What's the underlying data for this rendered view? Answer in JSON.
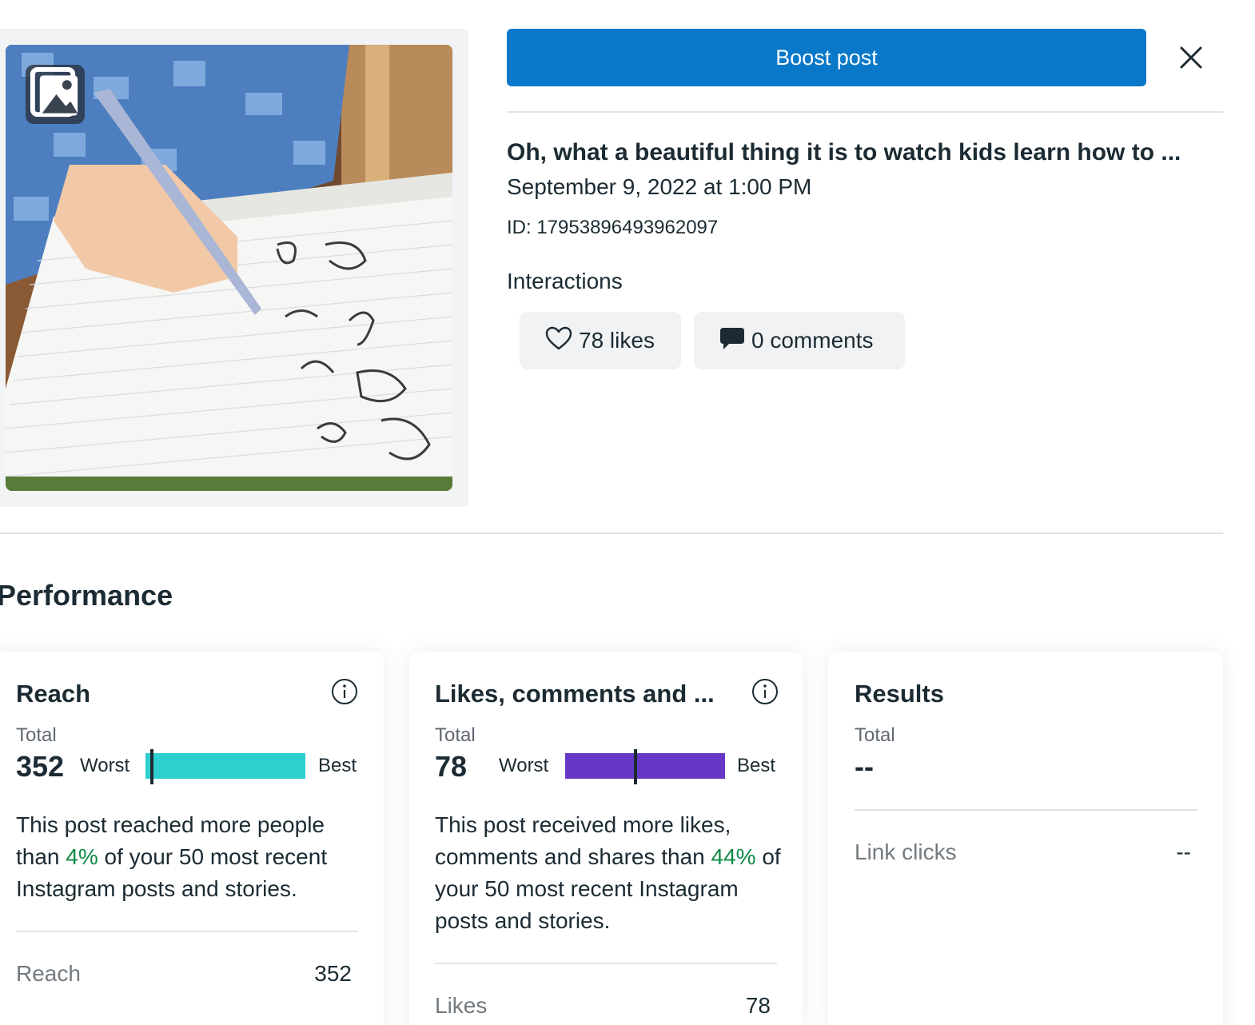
{
  "header": {
    "boost_label": "Boost post",
    "close_icon": "close-icon"
  },
  "media": {
    "type_icon": "photo-gallery-icon",
    "photo_subject": "child-writing-alphabet-photo"
  },
  "post": {
    "title": "Oh, what a beautiful thing it is to watch kids learn how to ...",
    "date": "September 9, 2022 at 1:00 PM",
    "id": "ID: 17953896493962097"
  },
  "interactions": {
    "heading": "Interactions",
    "likes": "78 likes",
    "likes_icon": "heart-icon",
    "comments": "0 comments",
    "comments_icon": "comment-bubble-icon"
  },
  "performance": {
    "title": "Performance",
    "cards": [
      {
        "title": "Reach",
        "total_label": "Total",
        "total": "352",
        "worst_label": "Worst",
        "best_label": "Best",
        "percentile": 0.04,
        "bar_color": "#2ecfcf",
        "desc_before": "This post reached more people than ",
        "desc_pct": "4%",
        "desc_after": " of your 50 most recent Instagram posts and stories.",
        "row_label": "Reach",
        "row_value": "352"
      },
      {
        "title": "Likes, comments and ...",
        "total_label": "Total",
        "total": "78",
        "worst_label": "Worst",
        "best_label": "Best",
        "percentile": 0.44,
        "bar_color": "#6539c6",
        "desc_before": "This post received more likes, comments and shares than ",
        "desc_pct": "44%",
        "desc_after": " of your 50 most recent Instagram posts and stories.",
        "row_label": "Likes",
        "row_value": "78"
      },
      {
        "title": "Results",
        "total_label": "Total",
        "total": "--",
        "row_label": "Link clicks",
        "row_value": "--"
      }
    ]
  },
  "colors": {
    "accent": "#0a78c8",
    "positive": "#0e8a47"
  }
}
